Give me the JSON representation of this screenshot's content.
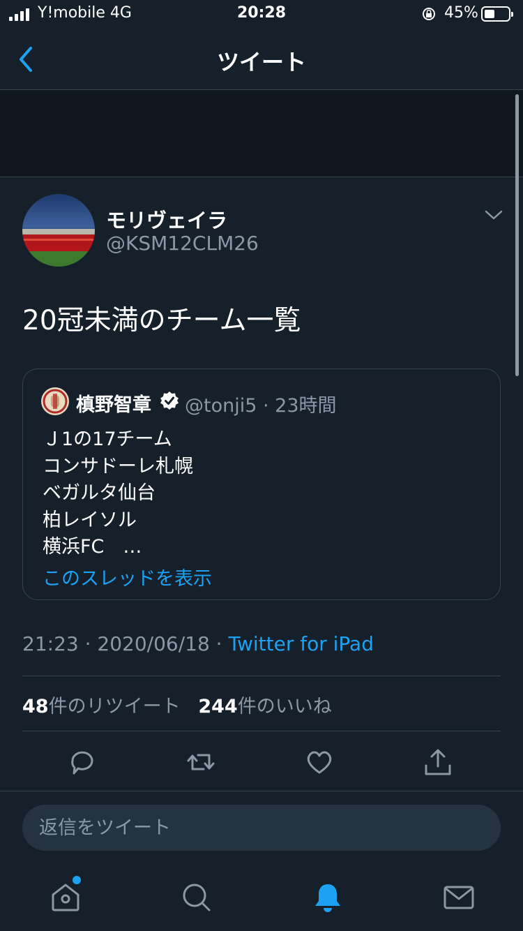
{
  "status_bar": {
    "carrier": "Y!mobile  4G",
    "time": "20:28",
    "battery": "45%"
  },
  "nav": {
    "title": "ツイート"
  },
  "tweet": {
    "display_name": "モリヴェイラ",
    "handle": "@KSM12CLM26",
    "text": "20冠未満のチーム一覧",
    "date": "21:23 · 2020/06/18 · ",
    "client": "Twitter for iPad",
    "retweet_count": "48",
    "retweet_label": "件のリツイート",
    "like_count": "244",
    "like_label": "件のいいね"
  },
  "quote": {
    "name": "槙野智章",
    "handle_time": "@tonji5 · 23時間",
    "lines": [
      "Ｊ1の17チーム",
      "コンサドーレ札幌",
      "ベガルタ仙台",
      "柏レイソル",
      "横浜FC　…"
    ],
    "show_thread": "このスレッドを表示"
  },
  "reply": {
    "placeholder": "返信をツイート"
  },
  "icons": {
    "back": "chevron-left-icon",
    "menu": "chevron-down-icon",
    "reply": "comment-icon",
    "retweet": "retweet-icon",
    "like": "heart-icon",
    "share": "share-icon",
    "home": "home-icon",
    "search": "search-icon",
    "notifications": "bell-icon",
    "messages": "mail-icon"
  },
  "colors": {
    "background": "#15202b",
    "accent": "#1da1f2",
    "secondary_text": "#8b98a5",
    "divider": "#38444d"
  }
}
